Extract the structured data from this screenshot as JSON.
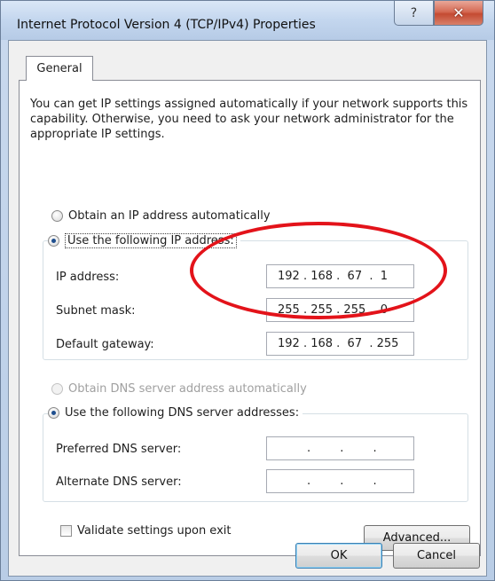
{
  "window": {
    "title": "Internet Protocol Version 4 (TCP/IPv4) Properties",
    "help_label": "?",
    "close_label": "✕"
  },
  "tabs": [
    {
      "label": "General"
    }
  ],
  "intro_text": "You can get IP settings assigned automatically if your network supports this capability. Otherwise, you need to ask your network administrator for the appropriate IP settings.",
  "ip_section": {
    "auto_label": "Obtain an IP address automatically",
    "manual_label": "Use the following IP address:",
    "selected": "manual",
    "fields": [
      {
        "label": "IP address:",
        "value": "192 . 168 .  67  .  1"
      },
      {
        "label": "Subnet mask:",
        "value": "255 . 255 . 255 .  0"
      },
      {
        "label": "Default gateway:",
        "value": "192 . 168 .  67  . 255"
      }
    ]
  },
  "dns_section": {
    "auto_label": "Obtain DNS server address automatically",
    "manual_label": "Use the following DNS server addresses:",
    "selected": "manual",
    "fields": [
      {
        "label": "Preferred DNS server:",
        "value": "        .        .        ."
      },
      {
        "label": "Alternate DNS server:",
        "value": "        .        .        ."
      }
    ]
  },
  "validate_label": "Validate settings upon exit",
  "advanced_label": "Advanced...",
  "ok_label": "OK",
  "cancel_label": "Cancel",
  "colors": {
    "annotation": "#e3131a",
    "title_bar": "#c3d6ee",
    "close_button": "#c44a32"
  }
}
